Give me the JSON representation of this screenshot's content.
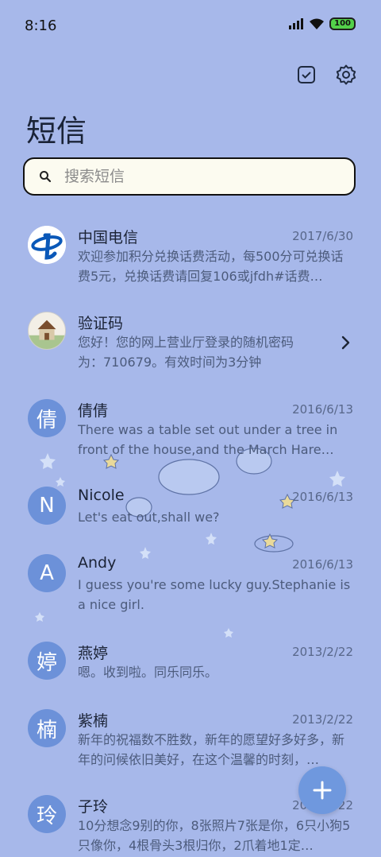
{
  "status": {
    "time": "8:16",
    "battery": "100"
  },
  "app": {
    "title": "短信"
  },
  "search": {
    "placeholder": "搜索短信"
  },
  "messages": [
    {
      "name": "中国电信",
      "date": "2017/6/30",
      "preview": "欢迎参加积分兑换话费活动，每500分可兑换话费5元，兑换话费请回复106或jfdh#话费…",
      "avatar": ""
    },
    {
      "name": "验证码",
      "date": "",
      "preview": "您好！您的网上营业厅登录的随机密码为：710679。有效时间为3分钟",
      "avatar": ""
    },
    {
      "name": "倩倩",
      "date": "2016/6/13",
      "preview": "There was a table set out under a tree in front of the house,and the March Hare an…",
      "avatar": "倩"
    },
    {
      "name": "Nicole",
      "date": "2016/6/13",
      "preview": "Let's eat out,shall we?",
      "avatar": "N"
    },
    {
      "name": "Andy",
      "date": "2016/6/13",
      "preview": "I guess you're some lucky guy.Stephanie is a nice girl.",
      "avatar": "A"
    },
    {
      "name": "燕婷",
      "date": "2013/2/22",
      "preview": "嗯。收到啦。同乐同乐。",
      "avatar": "婷"
    },
    {
      "name": "紫楠",
      "date": "2013/2/22",
      "preview": "新年的祝福数不胜数，新年的愿望好多好多，新年的问候依旧美好，在这个温馨的时刻，…",
      "avatar": "楠"
    },
    {
      "name": "子玲",
      "date": "2013/2/22",
      "preview": "10分想念9别的你，8张照片7张是你，6只小狗5只像你，4根骨头3根归你，2爪着地1定…",
      "avatar": "玲"
    }
  ],
  "colors": {
    "background": "#a7b8ea",
    "accent": "#6f98de",
    "avatar": "#6c91d9"
  },
  "icons": [
    "signal-icon",
    "wifi-icon",
    "battery-icon",
    "checkbox-icon",
    "settings-gear-icon",
    "search-icon",
    "chevron-right-icon",
    "plus-icon"
  ]
}
